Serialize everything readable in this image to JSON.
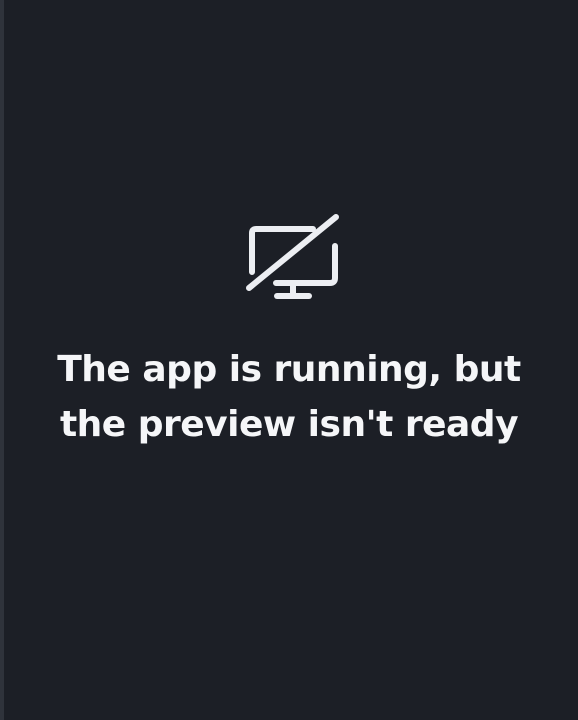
{
  "preview": {
    "status_icon": "monitor-off-icon",
    "message": "The app is running, but the preview isn't ready"
  },
  "colors": {
    "background": "#1c1f26",
    "border": "#2f333b",
    "text": "#f5f6f8",
    "icon": "#eceef2"
  }
}
